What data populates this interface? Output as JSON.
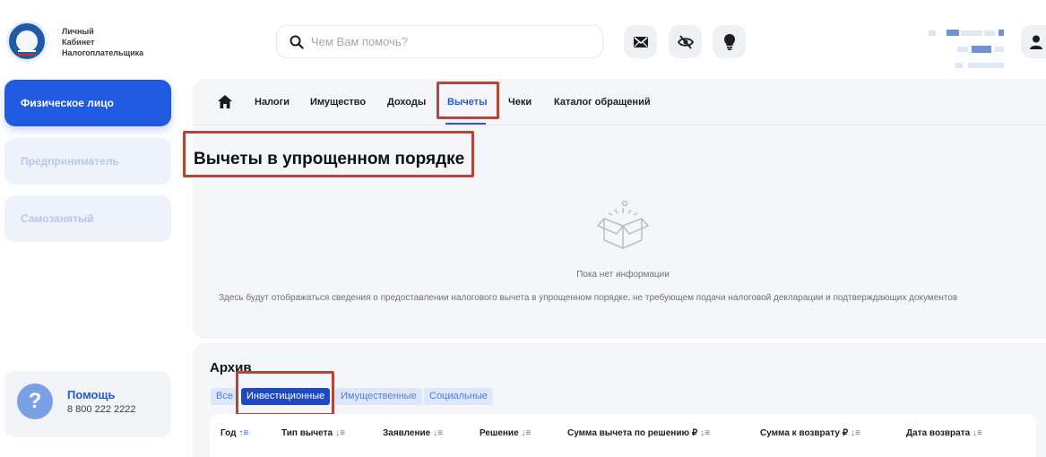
{
  "header": {
    "logo_lines": [
      "Личный",
      "Кабинет",
      "Налогоплательщика"
    ],
    "search_placeholder": "Чем Вам помочь?",
    "icons": [
      "mail-icon",
      "eye-off-icon",
      "bulb-icon",
      "user-icon"
    ]
  },
  "sidebar": {
    "items": [
      {
        "label": "Физическое лицо",
        "active": true
      },
      {
        "label": "Предприниматель",
        "active": false
      },
      {
        "label": "Самозанятый",
        "active": false
      }
    ],
    "help": {
      "title": "Помощь",
      "phone": "8 800 222 2222",
      "icon_glyph": "?"
    }
  },
  "nav": {
    "items": [
      "Налоги",
      "Имущество",
      "Доходы",
      "Вычеты",
      "Чеки",
      "Каталог обращений"
    ],
    "active": "Вычеты"
  },
  "main": {
    "title": "Вычеты в упрощенном порядке",
    "empty_title": "Пока нет информации",
    "empty_description": "Здесь будут отображаться сведения о предоставлении налогового вычета в упрощенном порядке, не требующем подачи налоговой декларации и подтверждающих документов"
  },
  "archive": {
    "title": "Архив",
    "tabs": [
      "Все",
      "Инвестиционные",
      "Имущественные",
      "Социальные"
    ],
    "active_tab": "Инвестиционные",
    "columns": [
      "Год",
      "Тип вычета",
      "Заявление",
      "Решение",
      "Сумма вычета по решению ₽",
      "Сумма к возврату ₽",
      "Дата возврата"
    ]
  },
  "colors": {
    "accent": "#1f5ae0",
    "highlight": "#b5453a",
    "panel": "#f5f6f9"
  }
}
